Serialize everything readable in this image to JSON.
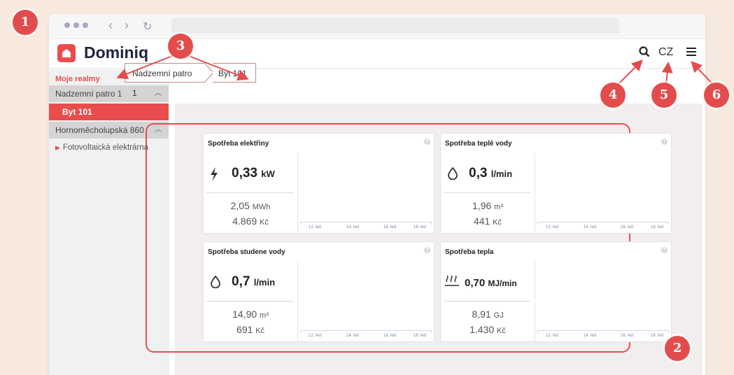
{
  "app": {
    "name": "Dominiq"
  },
  "browser": {
    "back": "‹",
    "forward": "›",
    "reload": "↻"
  },
  "header": {
    "language": "CZ"
  },
  "sidebar": {
    "title": "Moje realmy",
    "groups": [
      {
        "label": "Nadzemní patro 1",
        "items": [
          {
            "label": "Byt 101",
            "active": true
          }
        ]
      },
      {
        "label": "Hornoměcholupská 860",
        "items": [
          {
            "label": "Fotovoltaická elektrárna",
            "active": false
          }
        ]
      }
    ]
  },
  "breadcrumb": [
    "Nadzemní patro 1",
    "Byt 101"
  ],
  "cards": [
    {
      "title": "Spotřeba elektřiny",
      "icon": "lightning-icon",
      "value": "0,33",
      "unit": "kW",
      "sub1_value": "2,05",
      "sub1_unit": "MWh",
      "sub2_value": "4.869",
      "sub2_unit": "Kč",
      "axis_labels": [
        "12. led",
        "14. led",
        "16. led",
        "18. led"
      ]
    },
    {
      "title": "Spotřeba teplé vody",
      "icon": "water-drop-icon",
      "value": "0,3",
      "unit": "l/min",
      "sub1_value": "1,96",
      "sub1_unit": "m³",
      "sub2_value": "441",
      "sub2_unit": "Kč",
      "axis_labels": [
        "12. led",
        "14. led",
        "16. led",
        "18. led"
      ]
    },
    {
      "title": "Spotřeba studene vody",
      "icon": "water-drop-icon",
      "value": "0,7",
      "unit": "l/min",
      "sub1_value": "14,90",
      "sub1_unit": "m³",
      "sub2_value": "691",
      "sub2_unit": "Kč",
      "axis_labels": [
        "12. led",
        "14. led",
        "16. led",
        "18. led"
      ]
    },
    {
      "title": "Spotřeba tepla",
      "icon": "heat-icon",
      "value": "0,70",
      "unit": "MJ/min",
      "sub1_value": "8,91",
      "sub1_unit": "GJ",
      "sub2_value": "1.430",
      "sub2_unit": "Kč",
      "axis_labels": [
        "12. led",
        "14. led",
        "16. led",
        "18. led"
      ]
    }
  ],
  "help_glyph": "?",
  "badges": [
    "1",
    "2",
    "3",
    "4",
    "5",
    "6"
  ],
  "colors": {
    "accent": "#e94c4c",
    "badge": "#e34c4c",
    "background": "#f8e9df"
  }
}
